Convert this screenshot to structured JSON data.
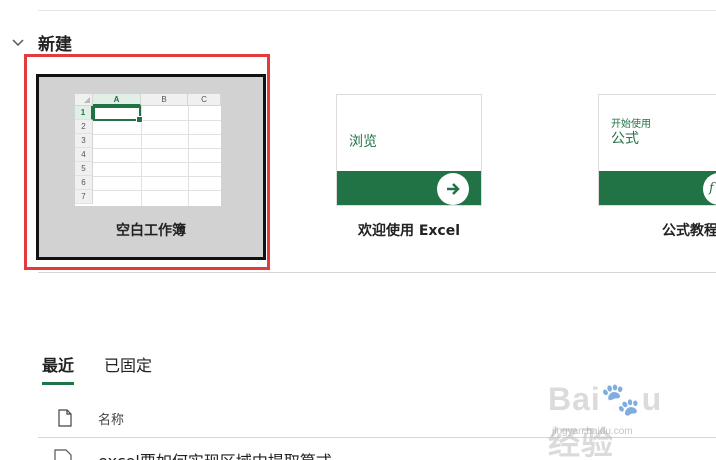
{
  "new_section": {
    "title": "新建",
    "collapse_icon": "chevron-down-icon"
  },
  "templates": [
    {
      "label": "空白工作簿"
    },
    {
      "label": "欢迎使用 Excel",
      "card_text": "浏览",
      "action_icon": "arrow-right-icon"
    },
    {
      "label": "公式教程",
      "card_small": "开始使用",
      "card_big": "公式",
      "action_icon": "fx-icon"
    }
  ],
  "blank_sheet": {
    "columns": [
      "A",
      "B",
      "C"
    ],
    "rows": [
      "1",
      "2",
      "3",
      "4",
      "5",
      "6",
      "7"
    ]
  },
  "tabs": [
    {
      "label": "最近",
      "active": true
    },
    {
      "label": "已固定",
      "active": false
    }
  ],
  "file_list": {
    "header_name": "名称",
    "rows": [
      {
        "name": "excel要如何实现区域中提取算式"
      }
    ]
  },
  "colors": {
    "excel_green": "#217346",
    "highlight_red": "#e33b3b",
    "selected_tile_bg": "#d2d2d2"
  }
}
